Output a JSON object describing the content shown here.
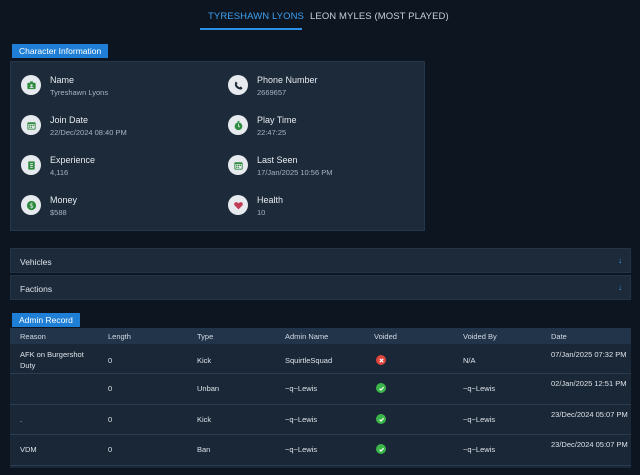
{
  "tabs": [
    {
      "label": "TYRESHAWN LYONS",
      "active": true
    },
    {
      "label": "LEON MYLES (MOST PLAYED)",
      "active": false
    }
  ],
  "character_panel": {
    "title": "Character Information",
    "fields": [
      {
        "label": "Name",
        "value": "Tyreshawn Lyons",
        "icon": "id-card-icon"
      },
      {
        "label": "Phone Number",
        "value": "2669657",
        "icon": "phone-icon"
      },
      {
        "label": "Join Date",
        "value": "22/Dec/2024 08:40 PM",
        "icon": "calendar-icon"
      },
      {
        "label": "Play Time",
        "value": "22:47:25",
        "icon": "stopwatch-icon"
      },
      {
        "label": "Experience",
        "value": "4,116",
        "icon": "book-icon"
      },
      {
        "label": "Last Seen",
        "value": "17/Jan/2025 10:56 PM",
        "icon": "calendar-icon"
      },
      {
        "label": "Money",
        "value": "$588",
        "icon": "dollar-icon"
      },
      {
        "label": "Health",
        "value": "10",
        "icon": "heart-icon"
      }
    ]
  },
  "accordions": [
    {
      "label": "Vehicles",
      "icon": "chevron-down-icon"
    },
    {
      "label": "Factions",
      "icon": "chevron-down-icon"
    }
  ],
  "admin_record": {
    "title": "Admin Record",
    "columns": [
      "Reason",
      "Length",
      "Type",
      "Admin Name",
      "Voided",
      "Voided By",
      "Date"
    ],
    "rows": [
      {
        "reason": "AFK on Burgershot Duty",
        "length": "0",
        "type": "Kick",
        "admin": "SquirtleSquad",
        "voided": false,
        "voided_by": "N/A",
        "date": "07/Jan/2025 07:32 PM"
      },
      {
        "reason": "",
        "length": "0",
        "type": "Unban",
        "admin": "~q~Lewis",
        "voided": true,
        "voided_by": "~q~Lewis",
        "date": "02/Jan/2025 12:51 PM"
      },
      {
        "reason": ".",
        "length": "0",
        "type": "Kick",
        "admin": "~q~Lewis",
        "voided": true,
        "voided_by": "~q~Lewis",
        "date": "23/Dec/2024 05:07 PM"
      },
      {
        "reason": "VDM",
        "length": "0",
        "type": "Ban",
        "admin": "~q~Lewis",
        "voided": true,
        "voided_by": "~q~Lewis",
        "date": "23/Dec/2024 05:07 PM"
      }
    ]
  },
  "colors": {
    "accent": "#1f7fd6",
    "tab_active": "#3fa0f0",
    "voided_yes": "#3bb44a",
    "voided_no": "#e0453d",
    "heart": "#c23b57",
    "panel_bg": "#1c2a3a",
    "page_bg": "#0c1520"
  }
}
